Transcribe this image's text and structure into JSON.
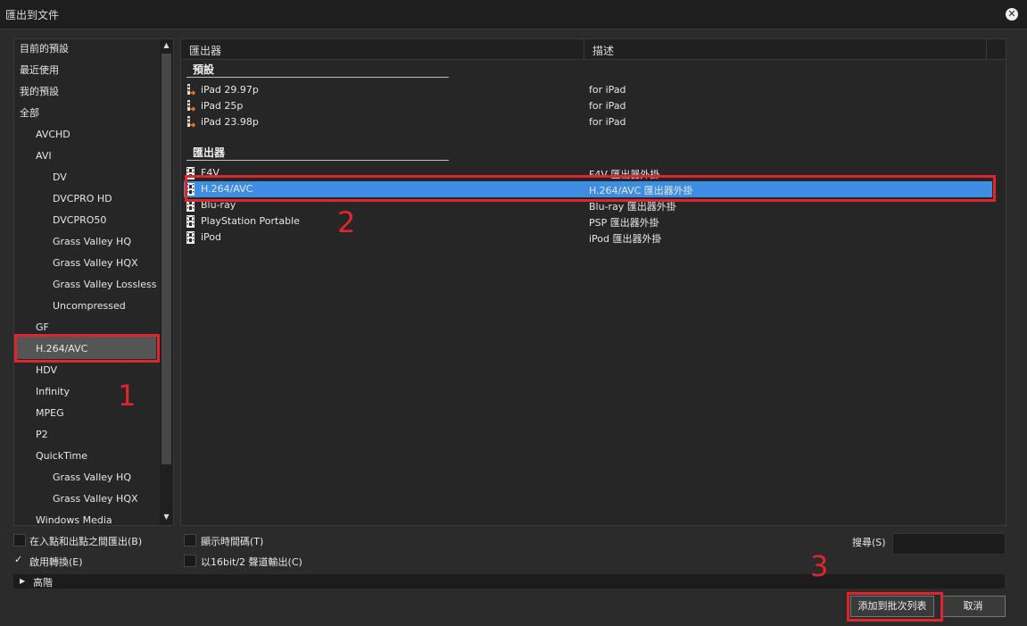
{
  "window": {
    "title": "匯出到文件"
  },
  "sidebar": {
    "items": [
      {
        "label": "目前的預設",
        "indent": 0
      },
      {
        "label": "最近使用",
        "indent": 0
      },
      {
        "label": "我的預設",
        "indent": 0
      },
      {
        "label": "全部",
        "indent": 0
      },
      {
        "label": "AVCHD",
        "indent": 1
      },
      {
        "label": "AVI",
        "indent": 1
      },
      {
        "label": "DV",
        "indent": 2
      },
      {
        "label": "DVCPRO HD",
        "indent": 2
      },
      {
        "label": "DVCPRO50",
        "indent": 2
      },
      {
        "label": "Grass Valley HQ",
        "indent": 2
      },
      {
        "label": "Grass Valley HQX",
        "indent": 2
      },
      {
        "label": "Grass Valley Lossless",
        "indent": 2
      },
      {
        "label": "Uncompressed",
        "indent": 2
      },
      {
        "label": "GF",
        "indent": 1
      },
      {
        "label": "H.264/AVC",
        "indent": 1,
        "selected": true
      },
      {
        "label": "HDV",
        "indent": 1
      },
      {
        "label": "Infinity",
        "indent": 1
      },
      {
        "label": "MPEG",
        "indent": 1
      },
      {
        "label": "P2",
        "indent": 1
      },
      {
        "label": "QuickTime",
        "indent": 1
      },
      {
        "label": "Grass Valley HQ",
        "indent": 2
      },
      {
        "label": "Grass Valley HQX",
        "indent": 2
      },
      {
        "label": "Windows Media",
        "indent": 1
      }
    ]
  },
  "table": {
    "col_exporter": "匯出器",
    "col_description": "描述",
    "group_presets": "預設",
    "group_exporters": "匯出器",
    "presets": [
      {
        "name": "iPad 29.97p",
        "desc": "for iPad"
      },
      {
        "name": "iPad 25p",
        "desc": "for iPad"
      },
      {
        "name": "iPad 23.98p",
        "desc": "for iPad"
      }
    ],
    "exporters": [
      {
        "name": "F4V",
        "desc": "F4V 匯出器外掛"
      },
      {
        "name": "H.264/AVC",
        "desc": "H.264/AVC 匯出器外掛",
        "selected": true
      },
      {
        "name": "Blu-ray",
        "desc": "Blu-ray 匯出器外掛"
      },
      {
        "name": "PlayStation Portable",
        "desc": "PSP 匯出器外掛"
      },
      {
        "name": "iPod",
        "desc": "iPod 匯出器外掛"
      }
    ]
  },
  "options": {
    "in_out": "在入點和出點之間匯出(B)",
    "enable_convert": "啟用轉換(E)",
    "show_timecode": "顯示時間碼(T)",
    "bit16": "以16bit/2 聲道輸出(C)",
    "search_label": "搜尋(S)",
    "advanced": "高階"
  },
  "buttons": {
    "add_batch": "添加到批次列表",
    "cancel": "取消"
  },
  "annotations": {
    "n1": "1",
    "n2": "2",
    "n3": "3",
    "color": "#e0262b"
  }
}
